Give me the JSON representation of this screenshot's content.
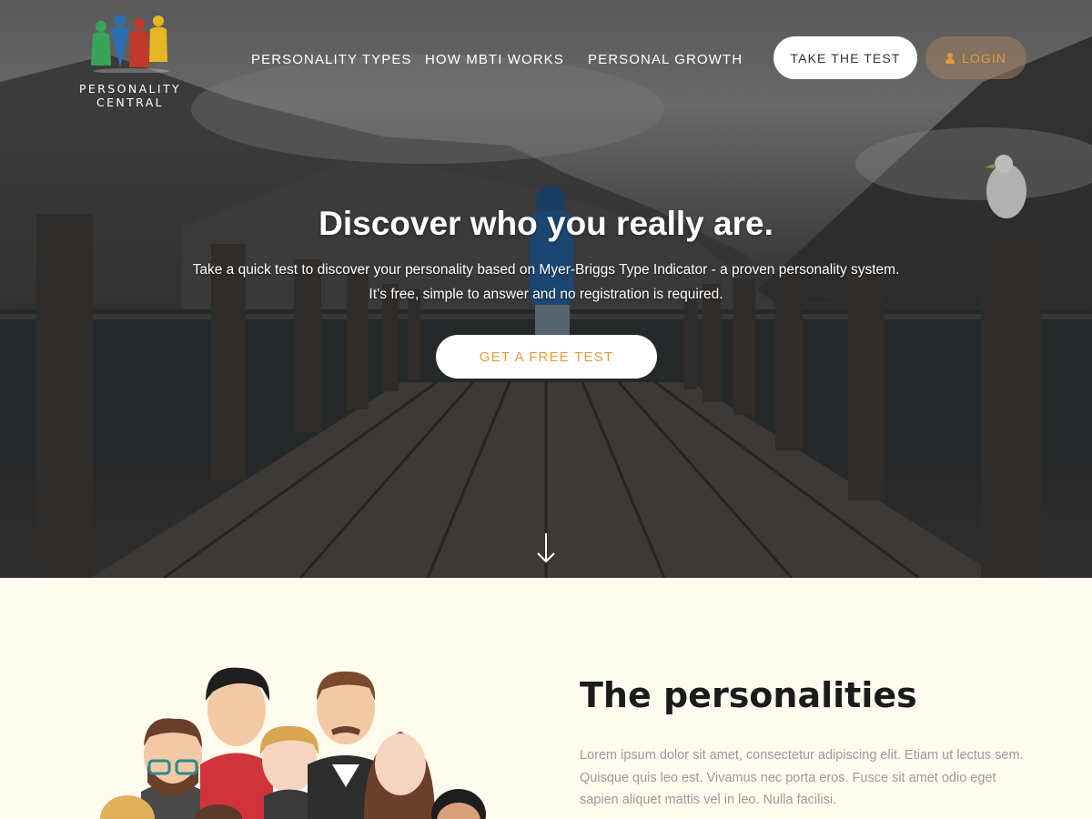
{
  "brand": {
    "line1": "PERSONALITY",
    "line2": "CENTRAL",
    "figure_colors": [
      "#3aa35a",
      "#2a6fb5",
      "#c0392b",
      "#e5b823"
    ]
  },
  "nav": {
    "items": [
      "PERSONALITY TYPES",
      "HOW MBTI WORKS",
      "PERSONAL GROWTH"
    ],
    "take_test": "TAKE THE TEST",
    "login": "LOGIN",
    "login_icon": "user-icon"
  },
  "hero": {
    "title": "Discover who you really are.",
    "subtitle_line1": "Take a quick test to discover your personality based on Myer-Briggs Type Indicator - a proven personality system.",
    "subtitle_line2": "It’s free, simple to answer and no registration is required.",
    "cta": "GET A FREE TEST",
    "scroll_icon": "arrow-down-icon"
  },
  "section": {
    "title": "The personalities",
    "body": "Lorem ipsum dolor sit amet, consectetur adipiscing elit. Etiam ut lectus sem. Quisque quis leo est. Vivamus nec porta eros. Fusce sit amet odio eget sapien aliquet mattis vel in leo. Nulla facilisi."
  },
  "colors": {
    "accent": "#e39a3c",
    "section_bg": "#fefcef",
    "heading": "#1b1b1b",
    "body_text": "#9a9a9a"
  }
}
